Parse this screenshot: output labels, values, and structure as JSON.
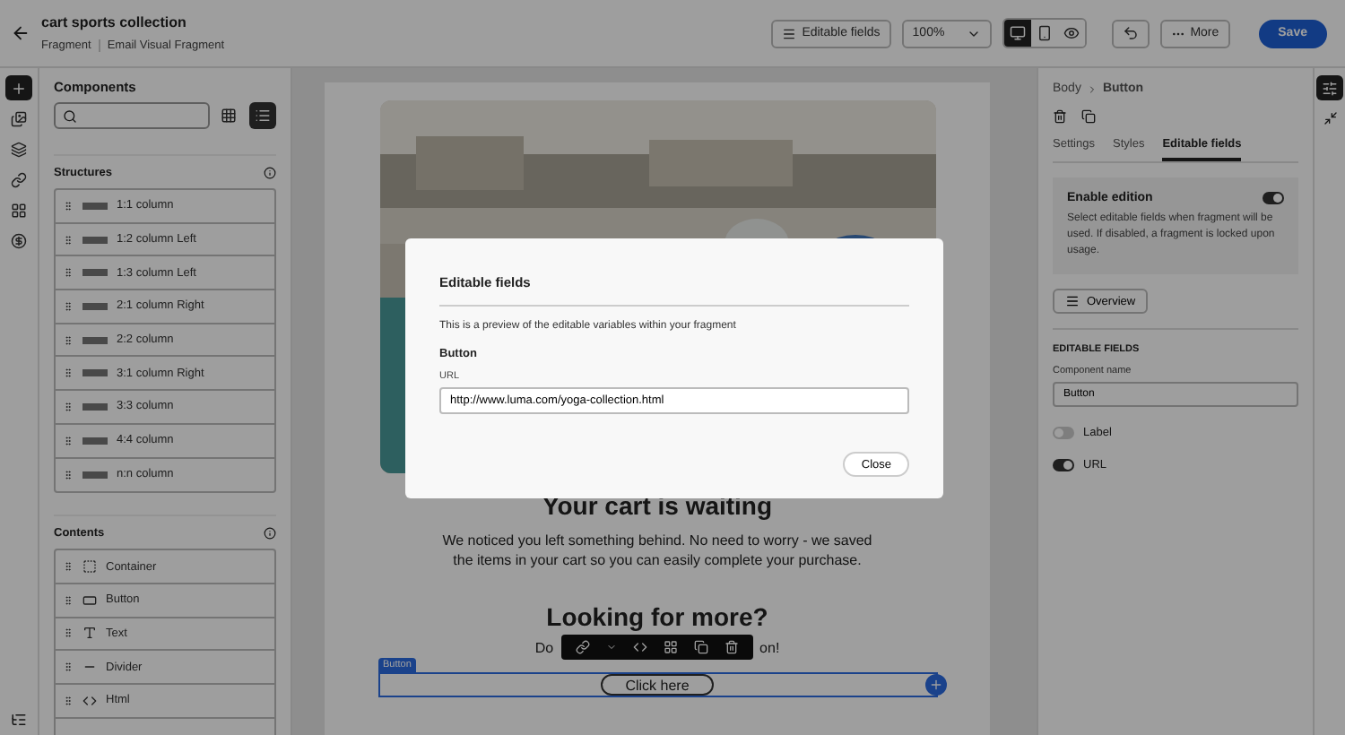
{
  "header": {
    "title": "cart sports collection",
    "breadcrumbs": [
      "Fragment",
      "Email Visual Fragment"
    ]
  },
  "toolbar": {
    "editable_fields": "Editable fields",
    "zoom": "100%",
    "views": [
      {
        "kind": "desktop",
        "selected": true
      },
      {
        "kind": "mobile",
        "selected": false
      },
      {
        "kind": "preview",
        "selected": false
      }
    ],
    "more": "More",
    "save": "Save"
  },
  "rail": [
    {
      "kind": "add",
      "selected": true
    },
    {
      "kind": "assets",
      "selected": false
    },
    {
      "kind": "layers",
      "selected": false
    },
    {
      "kind": "link",
      "selected": false
    },
    {
      "kind": "fragments",
      "selected": false
    },
    {
      "kind": "personalize",
      "selected": false
    }
  ],
  "components": {
    "title": "Components",
    "views": [
      {
        "kind": "grid",
        "selected": false
      },
      {
        "kind": "list",
        "selected": true
      }
    ],
    "structures": {
      "title": "Structures",
      "items": [
        "1:1 column",
        "1:2 column Left",
        "1:3 column Left",
        "2:1 column Right",
        "2:2 column",
        "3:1 column Right",
        "3:3 column",
        "4:4 column",
        "n:n column"
      ]
    },
    "contents": {
      "title": "Contents",
      "items": [
        {
          "kind": "container",
          "label": "Container"
        },
        {
          "kind": "button",
          "label": "Button"
        },
        {
          "kind": "text",
          "label": "Text"
        },
        {
          "kind": "divider",
          "label": "Divider"
        },
        {
          "kind": "html",
          "label": "Html"
        }
      ]
    }
  },
  "email": {
    "heading": "Your cart is waiting",
    "body": "We noticed you left something behind. No need to worry - we saved the items in your cart so you can easily complete your purchase.",
    "heading_2": "Looking for more?",
    "body_2_start": "Do",
    "body_2_end": "on!",
    "selection_tag": "Button",
    "button": "Click here"
  },
  "inspector": {
    "breadcrumb": [
      "Body",
      "Button"
    ],
    "tabs": [
      {
        "label": "Settings",
        "selected": false
      },
      {
        "label": "Styles",
        "selected": false
      },
      {
        "label": "Editable fields",
        "selected": true
      }
    ],
    "enable": {
      "title": "Enable edition",
      "on": true,
      "description": "Select editable fields when fragment will be used. If disabled, a fragment is locked upon usage."
    },
    "overview": "Overview",
    "section": "EDITABLE FIELDS",
    "component_name": {
      "label": "Component name",
      "value": "Button"
    },
    "fields": [
      {
        "label": "Label",
        "on": false
      },
      {
        "label": "URL",
        "on": true
      }
    ]
  },
  "modal": {
    "title": "Editable fields",
    "intro": "This is a preview of the editable variables within your fragment",
    "group": "Button",
    "field_label": "URL",
    "value": "http://www.luma.com/yoga-collection.html",
    "close": "Close"
  }
}
